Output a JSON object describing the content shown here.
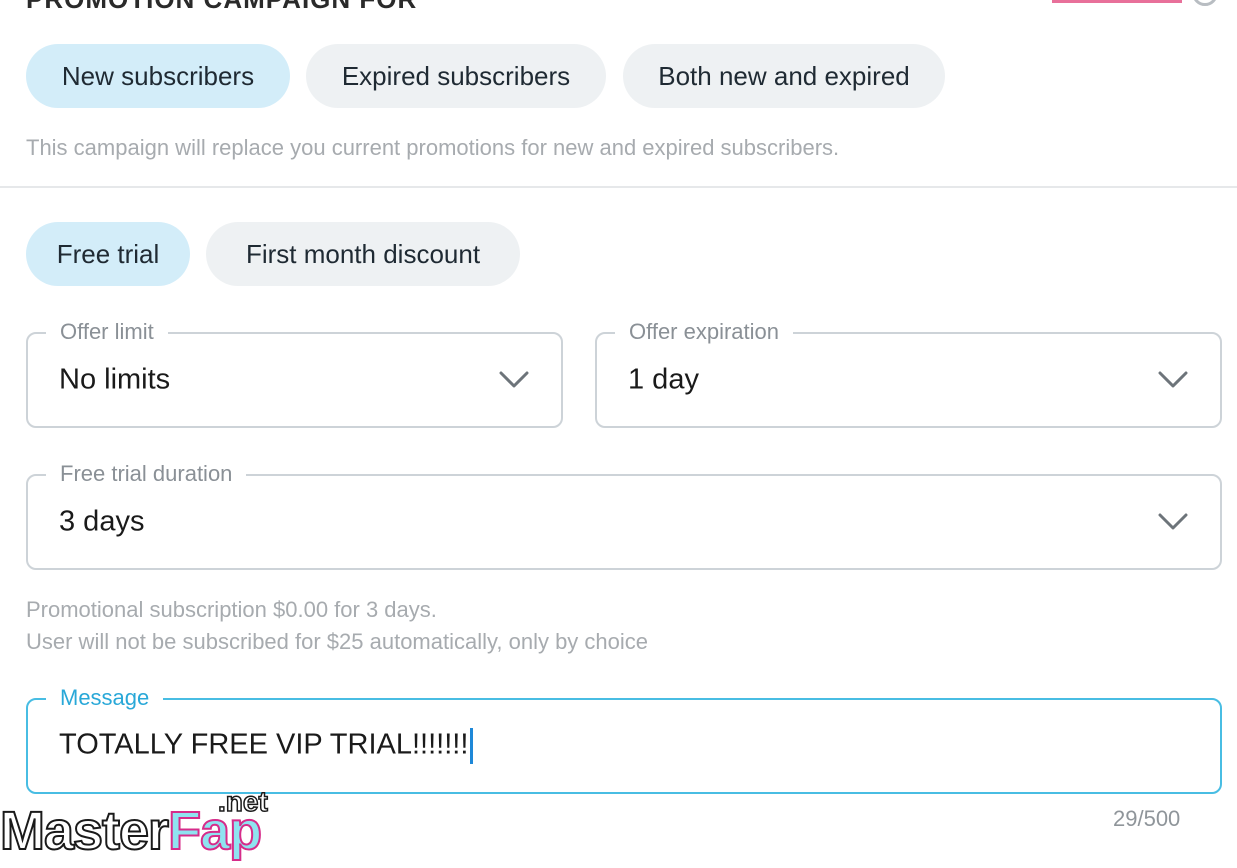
{
  "header": {
    "title": "PROMOTION CAMPAIGN FOR"
  },
  "audience": {
    "options": [
      {
        "label": "New subscribers",
        "active": true
      },
      {
        "label": "Expired subscribers",
        "active": false
      },
      {
        "label": "Both new and expired",
        "active": false
      }
    ],
    "note": "This campaign will replace you current promotions for new and expired subscribers."
  },
  "offer_type": {
    "options": [
      {
        "label": "Free trial",
        "active": true
      },
      {
        "label": "First month discount",
        "active": false
      }
    ]
  },
  "fields": {
    "offer_limit": {
      "label": "Offer limit",
      "value": "No limits",
      "icon": "chevron-down-icon"
    },
    "offer_expiration": {
      "label": "Offer expiration",
      "value": "1 day",
      "icon": "chevron-down-icon"
    },
    "free_trial_duration": {
      "label": "Free trial duration",
      "value": "3 days",
      "icon": "chevron-down-icon"
    }
  },
  "summary": {
    "line1": "Promotional subscription $0.00 for 3 days.",
    "line2": "User will not be subscribed for $25 automatically, only by choice"
  },
  "message": {
    "label": "Message",
    "value": "TOTALLY FREE VIP TRIAL!!!!!!!",
    "counter": "29/500"
  },
  "watermark": {
    "text_main": "Master",
    "text_accent": "Fap",
    "text_suffix": ".net"
  },
  "colors": {
    "pill_active": "#d3edf9",
    "pill_inactive": "#eef1f3",
    "focus_accent": "#48bde3",
    "top_accent": "#e8709a"
  }
}
